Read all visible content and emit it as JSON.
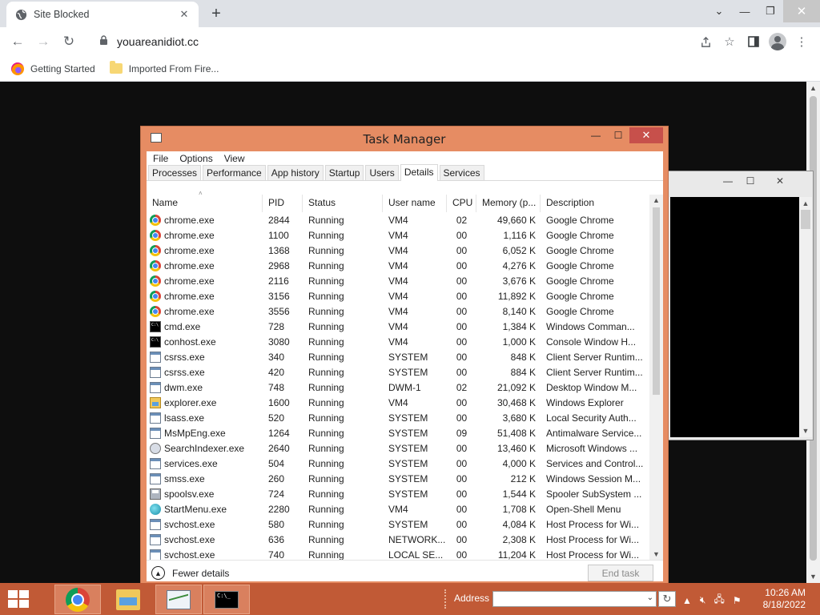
{
  "browser": {
    "tab_title": "Site Blocked",
    "tab_close": "✕",
    "new_tab": "+",
    "url": "youareanidiot.cc",
    "bookmarks": [
      {
        "label": "Getting Started",
        "icon": "firefox-icon"
      },
      {
        "label": "Imported From Fire...",
        "icon": "folder-icon"
      }
    ]
  },
  "taskmanager": {
    "title": "Task Manager",
    "menu": [
      "File",
      "Options",
      "View"
    ],
    "tabs": [
      "Processes",
      "Performance",
      "App history",
      "Startup",
      "Users",
      "Details",
      "Services"
    ],
    "active_tab": "Details",
    "columns": [
      "Name",
      "PID",
      "Status",
      "User name",
      "CPU",
      "Memory (p...",
      "Description"
    ],
    "sort_indicator": "˄",
    "rows": [
      {
        "icon": "chrome",
        "name": "chrome.exe",
        "pid": "2844",
        "status": "Running",
        "user": "VM4",
        "cpu": "02",
        "mem": "49,660 K",
        "desc": "Google Chrome"
      },
      {
        "icon": "chrome",
        "name": "chrome.exe",
        "pid": "1100",
        "status": "Running",
        "user": "VM4",
        "cpu": "00",
        "mem": "1,116 K",
        "desc": "Google Chrome"
      },
      {
        "icon": "chrome",
        "name": "chrome.exe",
        "pid": "1368",
        "status": "Running",
        "user": "VM4",
        "cpu": "00",
        "mem": "6,052 K",
        "desc": "Google Chrome"
      },
      {
        "icon": "chrome",
        "name": "chrome.exe",
        "pid": "2968",
        "status": "Running",
        "user": "VM4",
        "cpu": "00",
        "mem": "4,276 K",
        "desc": "Google Chrome"
      },
      {
        "icon": "chrome",
        "name": "chrome.exe",
        "pid": "2116",
        "status": "Running",
        "user": "VM4",
        "cpu": "00",
        "mem": "3,676 K",
        "desc": "Google Chrome"
      },
      {
        "icon": "chrome",
        "name": "chrome.exe",
        "pid": "3156",
        "status": "Running",
        "user": "VM4",
        "cpu": "00",
        "mem": "11,892 K",
        "desc": "Google Chrome"
      },
      {
        "icon": "chrome",
        "name": "chrome.exe",
        "pid": "3556",
        "status": "Running",
        "user": "VM4",
        "cpu": "00",
        "mem": "8,140 K",
        "desc": "Google Chrome"
      },
      {
        "icon": "cmd",
        "name": "cmd.exe",
        "pid": "728",
        "status": "Running",
        "user": "VM4",
        "cpu": "00",
        "mem": "1,384 K",
        "desc": "Windows Comman..."
      },
      {
        "icon": "cmd",
        "name": "conhost.exe",
        "pid": "3080",
        "status": "Running",
        "user": "VM4",
        "cpu": "00",
        "mem": "1,000 K",
        "desc": "Console Window H..."
      },
      {
        "icon": "win",
        "name": "csrss.exe",
        "pid": "340",
        "status": "Running",
        "user": "SYSTEM",
        "cpu": "00",
        "mem": "848 K",
        "desc": "Client Server Runtim..."
      },
      {
        "icon": "win",
        "name": "csrss.exe",
        "pid": "420",
        "status": "Running",
        "user": "SYSTEM",
        "cpu": "00",
        "mem": "884 K",
        "desc": "Client Server Runtim..."
      },
      {
        "icon": "win",
        "name": "dwm.exe",
        "pid": "748",
        "status": "Running",
        "user": "DWM-1",
        "cpu": "02",
        "mem": "21,092 K",
        "desc": "Desktop Window M..."
      },
      {
        "icon": "explorer",
        "name": "explorer.exe",
        "pid": "1600",
        "status": "Running",
        "user": "VM4",
        "cpu": "00",
        "mem": "30,468 K",
        "desc": "Windows Explorer"
      },
      {
        "icon": "win",
        "name": "lsass.exe",
        "pid": "520",
        "status": "Running",
        "user": "SYSTEM",
        "cpu": "00",
        "mem": "3,680 K",
        "desc": "Local Security Auth..."
      },
      {
        "icon": "win",
        "name": "MsMpEng.exe",
        "pid": "1264",
        "status": "Running",
        "user": "SYSTEM",
        "cpu": "09",
        "mem": "51,408 K",
        "desc": "Antimalware Service..."
      },
      {
        "icon": "search",
        "name": "SearchIndexer.exe",
        "pid": "2640",
        "status": "Running",
        "user": "SYSTEM",
        "cpu": "00",
        "mem": "13,460 K",
        "desc": "Microsoft Windows ..."
      },
      {
        "icon": "win",
        "name": "services.exe",
        "pid": "504",
        "status": "Running",
        "user": "SYSTEM",
        "cpu": "00",
        "mem": "4,000 K",
        "desc": "Services and Control..."
      },
      {
        "icon": "win",
        "name": "smss.exe",
        "pid": "260",
        "status": "Running",
        "user": "SYSTEM",
        "cpu": "00",
        "mem": "212 K",
        "desc": "Windows Session M..."
      },
      {
        "icon": "printer",
        "name": "spoolsv.exe",
        "pid": "724",
        "status": "Running",
        "user": "SYSTEM",
        "cpu": "00",
        "mem": "1,544 K",
        "desc": "Spooler SubSystem ..."
      },
      {
        "icon": "startmenu",
        "name": "StartMenu.exe",
        "pid": "2280",
        "status": "Running",
        "user": "VM4",
        "cpu": "00",
        "mem": "1,708 K",
        "desc": "Open-Shell Menu"
      },
      {
        "icon": "win",
        "name": "svchost.exe",
        "pid": "580",
        "status": "Running",
        "user": "SYSTEM",
        "cpu": "00",
        "mem": "4,084 K",
        "desc": "Host Process for Wi..."
      },
      {
        "icon": "win",
        "name": "svchost.exe",
        "pid": "636",
        "status": "Running",
        "user": "NETWORK...",
        "cpu": "00",
        "mem": "2,308 K",
        "desc": "Host Process for Wi..."
      },
      {
        "icon": "win",
        "name": "svchost.exe",
        "pid": "740",
        "status": "Running",
        "user": "LOCAL SE...",
        "cpu": "00",
        "mem": "11,204 K",
        "desc": "Host Process for Wi..."
      }
    ],
    "fewer_details": "Fewer details",
    "end_task": "End task"
  },
  "taskbar": {
    "address_label": "Address",
    "address_value": "",
    "time": "10:26 AM",
    "date": "8/18/2022"
  },
  "colors": {
    "taskbar": "#c15a36",
    "taskmanager_frame": "#e68c63",
    "close_button": "#c7504b"
  }
}
